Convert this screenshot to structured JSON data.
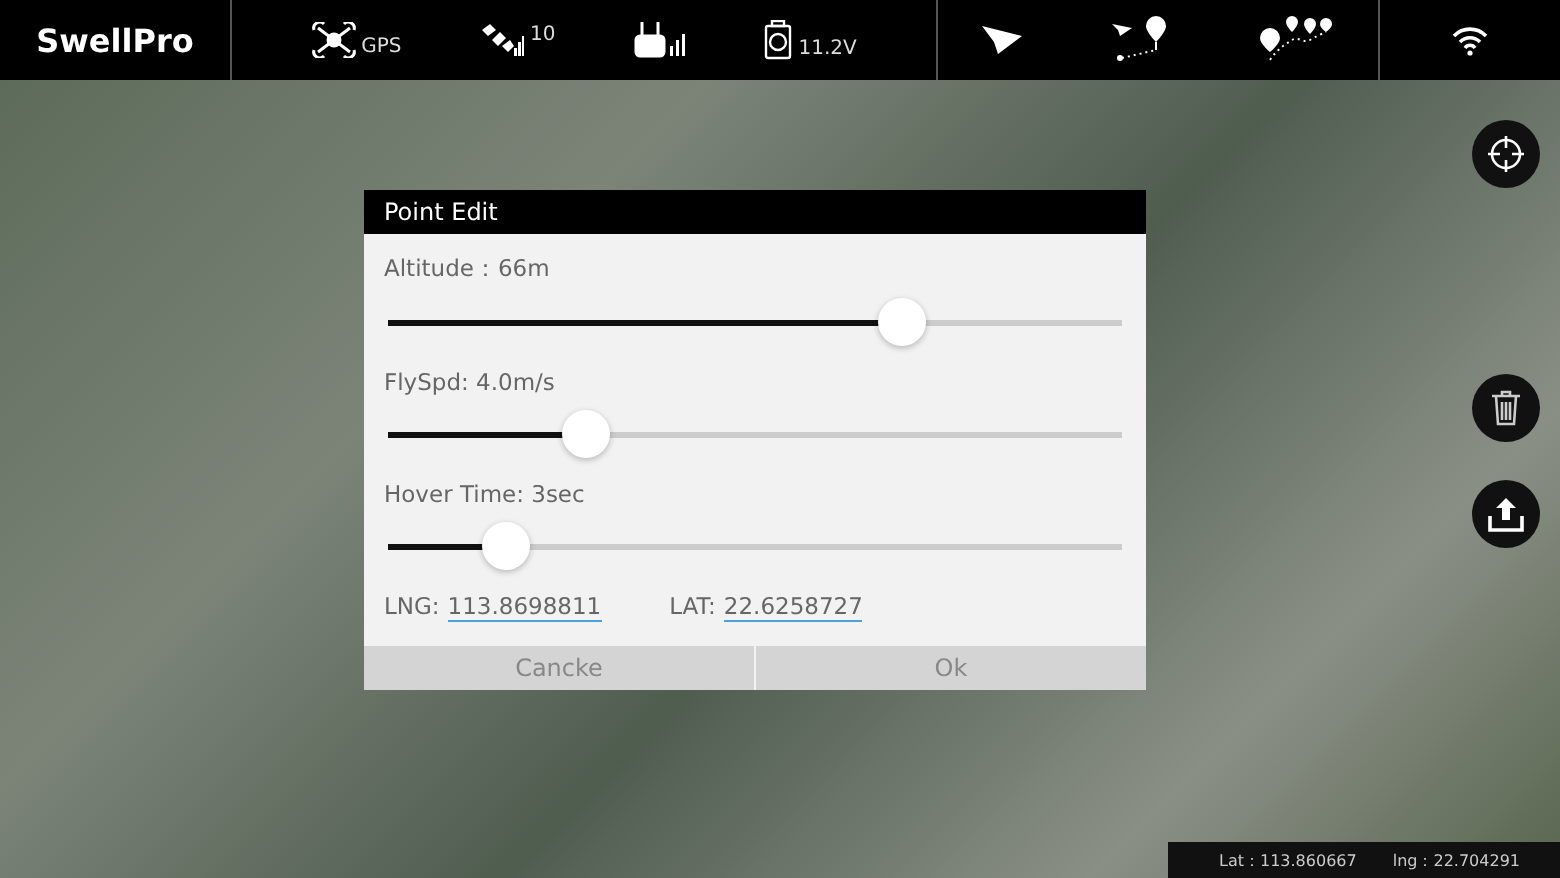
{
  "top_bar": {
    "logo": "SwellPro",
    "status": [
      {
        "kind": "drone",
        "text": "GPS"
      },
      {
        "kind": "satellite",
        "text": "10"
      },
      {
        "kind": "remote"
      },
      {
        "kind": "battery",
        "text": "11.2V"
      }
    ],
    "modes": [
      {
        "kind": "fly"
      },
      {
        "kind": "point"
      },
      {
        "kind": "waypoints"
      }
    ]
  },
  "dialog": {
    "title": "Point Edit",
    "sliders": [
      {
        "label": "Altitude：66m",
        "level": 0.7
      },
      {
        "label": "FlySpd: 4.0m/s",
        "level": 0.27
      },
      {
        "label": "Hover Time: 3sec",
        "level": 0.16
      }
    ],
    "lng_label": "LNG:",
    "lng": "113.8698811",
    "lat_label": "LAT:",
    "lat": "22.6258727",
    "buttons": [
      "Cancke",
      "Ok"
    ]
  },
  "coords_bar": {
    "lat": "Lat：113.860667",
    "lng": "lng：22.704291"
  }
}
